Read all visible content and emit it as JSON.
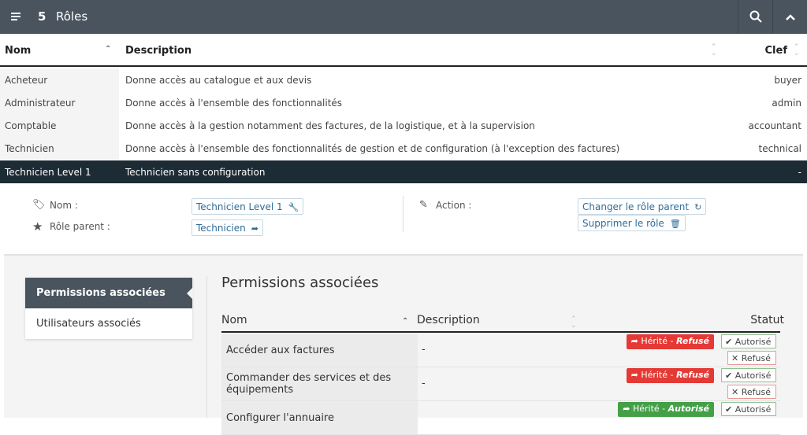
{
  "header": {
    "count": "5",
    "title": "Rôles"
  },
  "table": {
    "columns": [
      "Nom",
      "Description",
      "Clef"
    ],
    "rows": [
      {
        "name": "Acheteur",
        "description": "Donne accès au catalogue et aux devis",
        "key": "buyer"
      },
      {
        "name": "Administrateur",
        "description": "Donne accès à l'ensemble des fonctionnalités",
        "key": "admin"
      },
      {
        "name": "Comptable",
        "description": "Donne accès à la gestion notamment des factures, de la logistique, et à la supervision",
        "key": "accountant"
      },
      {
        "name": "Technicien",
        "description": "Donne accès à l'ensemble des fonctionnalités de gestion et de configuration (à l'exception des factures)",
        "key": "technical"
      },
      {
        "name": "Technicien Level 1",
        "description": "Technicien sans configuration",
        "key": "-"
      }
    ]
  },
  "detail": {
    "name_label": "Nom :",
    "name_value": "Technicien Level 1",
    "parent_label": "Rôle parent :",
    "parent_value": "Technicien",
    "action_label": "Action :",
    "change_parent": "Changer le rôle parent",
    "delete_role": "Supprimer le rôle"
  },
  "tabs": [
    "Permissions associées",
    "Utilisateurs associés"
  ],
  "permissions": {
    "title": "Permissions associées",
    "columns": [
      "Nom",
      "Description",
      "Statut"
    ],
    "rows": [
      {
        "name": "Accéder aux factures",
        "description": "-",
        "inherited": "Hérité -",
        "inherited_state": "Refusé",
        "allow": "Autorisé",
        "deny": "Refusé"
      },
      {
        "name": "Commander des services et des équipements",
        "description": "-",
        "inherited": "Hérité -",
        "inherited_state": "Refusé",
        "allow": "Autorisé",
        "deny": "Refusé"
      },
      {
        "name": "Configurer l'annuaire",
        "description": "",
        "inherited": "Hérité -",
        "inherited_state": "Autorisé",
        "allow": "Autorisé",
        "deny": ""
      }
    ]
  },
  "colors": {
    "topbar": "#4a545e",
    "selected_row": "#1d2b35",
    "denied": "#e53935",
    "granted": "#43a047",
    "link": "#2f6d99"
  }
}
